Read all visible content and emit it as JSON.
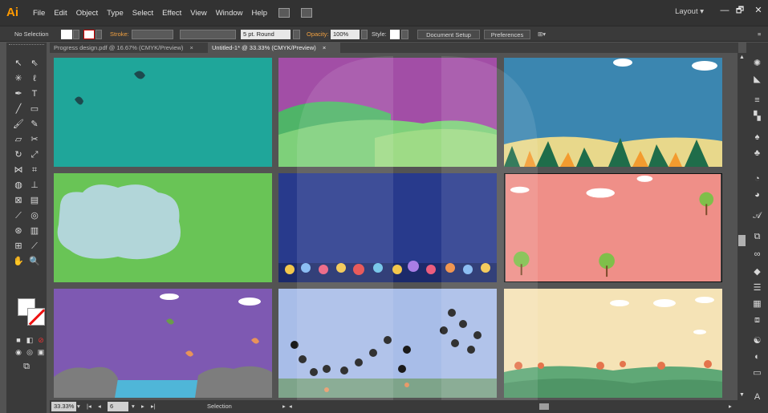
{
  "app": {
    "logo": "Ai",
    "menu": [
      "File",
      "Edit",
      "Object",
      "Type",
      "Select",
      "Effect",
      "View",
      "Window",
      "Help"
    ],
    "workspace": "Layout ▾",
    "window_controls": [
      "—",
      "🗗",
      "✕"
    ]
  },
  "control_bar": {
    "selection": "No Selection",
    "stroke_label": "Stroke:",
    "brush": "5 pt. Round",
    "opacity_label": "Opacity:",
    "opacity_value": "100%",
    "style_label": "Style:",
    "document_setup": "Document Setup",
    "preferences": "Preferences"
  },
  "tabs": [
    {
      "label": "Progress design.pdf @ 16.67% (CMYK/Preview)",
      "close": "×",
      "active": false
    },
    {
      "label": "Untitled-1* @ 33.33% (CMYK/Preview)",
      "close": "×",
      "active": true
    }
  ],
  "status_bar": {
    "zoom": "33.33%",
    "artboard_number": "6",
    "tool_name": "Selection"
  },
  "toolbar_icons": [
    "selection-tool",
    "direct-selection-tool",
    "magic-wand-tool",
    "lasso-tool",
    "pen-tool",
    "type-tool",
    "line-tool",
    "rectangle-tool",
    "paintbrush-tool",
    "pencil-tool",
    "eraser-tool",
    "scissors-tool",
    "rotate-tool",
    "scale-tool",
    "width-tool",
    "free-transform-tool",
    "shape-builder-tool",
    "perspective-tool",
    "mesh-tool",
    "gradient-tool",
    "eyedropper-tool",
    "blend-tool",
    "symbol-sprayer-tool",
    "column-graph-tool",
    "artboard-tool",
    "slice-tool",
    "hand-tool",
    "zoom-tool"
  ],
  "dock_icons": [
    "color-icon",
    "color-guide-icon",
    "swatches-icon",
    "brushes-icon",
    "symbols-icon",
    "graphic-styles-icon",
    "appearance-icon",
    "layers-icon",
    "type-icon",
    "artboards-icon",
    "links-icon",
    "transparency-icon",
    "align-icon",
    "transform-icon",
    "pathfinder-icon",
    "stroke-icon",
    "gradient-icon",
    "character-icon"
  ],
  "colors": {
    "teal": "#1fa69a",
    "purple": "#a24ea6",
    "sky": "#3b86b0",
    "green": "#69c456",
    "navy": "#283a8c",
    "salmon": "#ef8f88",
    "violet": "#7e59b2",
    "pale_blue": "#a8bde8",
    "cream": "#f5e3b6"
  }
}
